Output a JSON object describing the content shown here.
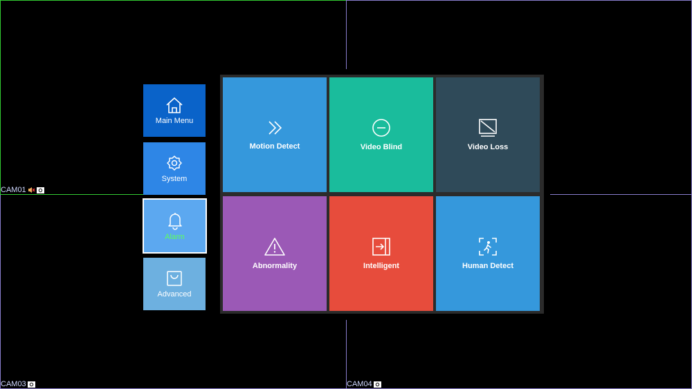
{
  "cameras": [
    {
      "label": "CAM01"
    },
    {
      "label": "CAM03"
    },
    {
      "label": "CAM04"
    }
  ],
  "sidebar": {
    "items": [
      {
        "label": "Main Menu",
        "icon": "home-icon",
        "color": "#0a63c9"
      },
      {
        "label": "System",
        "icon": "gear-icon",
        "color": "#2e86e6"
      },
      {
        "label": "Alarm",
        "icon": "bell-icon",
        "color": "#5ca8f0",
        "label_color": "#5cff5c"
      },
      {
        "label": "Advanced",
        "icon": "bag-icon",
        "color": "#6db0e0"
      }
    ]
  },
  "alarm_menu": {
    "tiles": [
      {
        "label": "Motion Detect",
        "icon": "double-chevron-icon",
        "color": "#3598dc"
      },
      {
        "label": "Video Blind",
        "icon": "minus-circle-icon",
        "color": "#1abc9c"
      },
      {
        "label": "Video Loss",
        "icon": "no-video-icon",
        "color": "#2f4a59"
      },
      {
        "label": "Abnormality",
        "icon": "warning-icon",
        "color": "#9b59b6"
      },
      {
        "label": "Intelligent",
        "icon": "enter-icon",
        "color": "#e74c3c"
      },
      {
        "label": "Human Detect",
        "icon": "human-detect-icon",
        "color": "#3598dc"
      }
    ]
  }
}
